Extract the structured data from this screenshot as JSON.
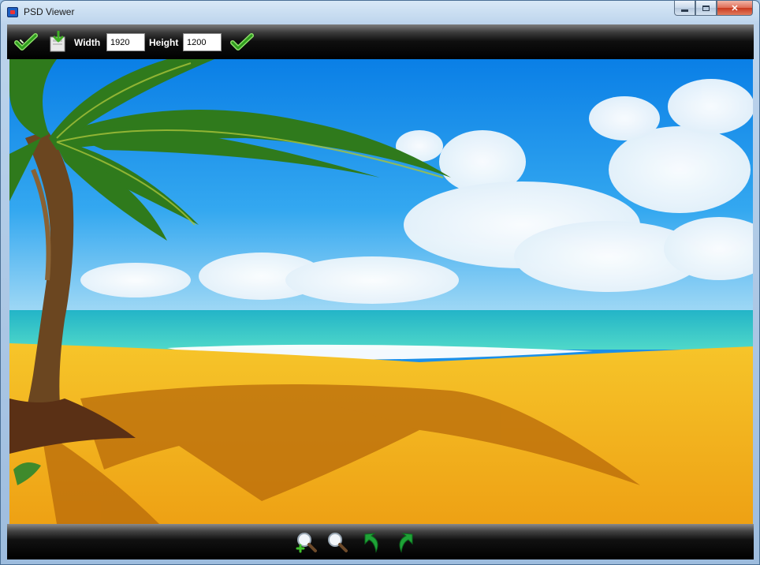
{
  "window": {
    "title": "PSD Viewer",
    "icon": "psd-viewer-app-icon",
    "controls": {
      "minimize": "minimize-icon",
      "maximize": "maximize-icon",
      "close": "close-icon"
    }
  },
  "toolbar": {
    "apply_icon": "checkmark-icon",
    "save_icon": "save-download-icon",
    "width_label": "Width",
    "width_value": "1920",
    "height_label": "Height",
    "height_value": "1200",
    "resize_confirm_icon": "checkmark-icon"
  },
  "image": {
    "subject": "tropical beach scene",
    "colors": {
      "sky": "#1b8fe8",
      "sea": "#2ec7c9",
      "sand": "#f2b51a"
    }
  },
  "bottombar": {
    "zoom_in_icon": "zoom-in-icon",
    "zoom_out_icon": "zoom-out-icon",
    "rotate_left_icon": "rotate-left-icon",
    "rotate_right_icon": "rotate-right-icon"
  },
  "colors": {
    "toolbar_bg": "#000000",
    "accent_green": "#3fbf2a",
    "title_bar": "#bcd4ec",
    "close_button": "#c9391f"
  }
}
